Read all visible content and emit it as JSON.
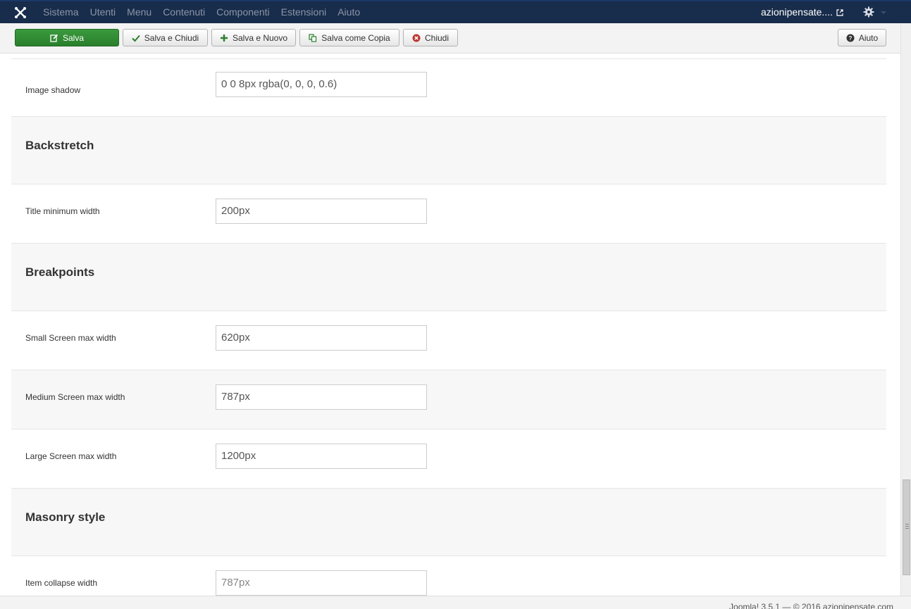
{
  "navbar": {
    "menu": [
      "Sistema",
      "Utenti",
      "Menu",
      "Contenuti",
      "Componenti",
      "Estensioni",
      "Aiuto"
    ],
    "site_name": "azionipensate...."
  },
  "toolbar": {
    "save": "Salva",
    "save_close": "Salva e Chiudi",
    "save_new": "Salva e Nuovo",
    "save_copy": "Salva come Copia",
    "close": "Chiudi",
    "help": "Aiuto"
  },
  "fields": {
    "image_shadow": {
      "label": "Image shadow",
      "value": "0 0 8px rgba(0, 0, 0, 0.6)"
    },
    "backstretch_heading": "Backstretch",
    "title_min_width": {
      "label": "Title minimum width",
      "value": "200px"
    },
    "breakpoints_heading": "Breakpoints",
    "small_screen": {
      "label": "Small Screen max width",
      "value": "620px"
    },
    "medium_screen": {
      "label": "Medium Screen max width",
      "value": "787px"
    },
    "large_screen": {
      "label": "Large Screen max width",
      "value": "1200px"
    },
    "masonry_heading": "Masonry style",
    "item_collapse": {
      "label": "Item collapse width",
      "placeholder": "787px"
    }
  },
  "footer": {
    "text": "Joomla! 3.5.1 — © 2016 azionipensate.com"
  }
}
